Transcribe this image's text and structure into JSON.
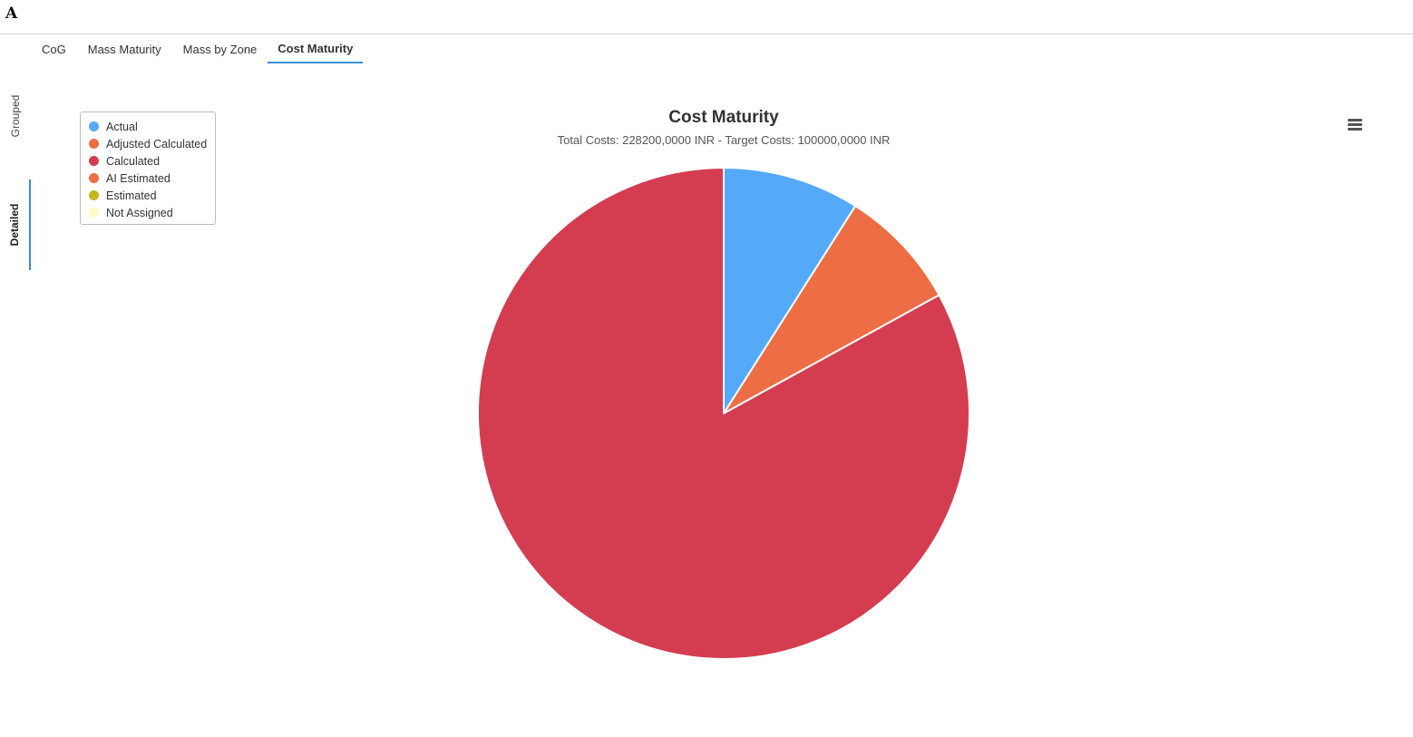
{
  "app": {
    "logo": "A"
  },
  "tabs": [
    {
      "label": "CoG",
      "active": false
    },
    {
      "label": "Mass Maturity",
      "active": false
    },
    {
      "label": "Mass by Zone",
      "active": false
    },
    {
      "label": "Cost Maturity",
      "active": true
    }
  ],
  "side_tabs": {
    "grouped": "Grouped",
    "detailed": "Detailed",
    "active": "detailed"
  },
  "menu_icon": "hamburger-menu-icon",
  "colors": {
    "accent": "#3a8fd8"
  },
  "chart_data": {
    "type": "pie",
    "title": "Cost Maturity",
    "subtitle": "Total Costs: 228200,0000 INR - Target Costs: 100000,0000 INR",
    "legend_position": "top-left",
    "legend": [
      {
        "name": "Actual",
        "color": "#55aaf8"
      },
      {
        "name": "Adjusted Calculated",
        "color": "#ed6d45"
      },
      {
        "name": "Calculated",
        "color": "#d43d50"
      },
      {
        "name": "AI Estimated",
        "color": "#ed6d45"
      },
      {
        "name": "Estimated",
        "color": "#c6b81c"
      },
      {
        "name": "Not Assigned",
        "color": "#fffac4"
      }
    ],
    "slices": [
      {
        "name": "Actual",
        "value": 9,
        "color": "#55aaf8"
      },
      {
        "name": "Adjusted Calculated",
        "value": 8,
        "color": "#ed6d45"
      },
      {
        "name": "Calculated",
        "value": 83,
        "color": "#d43d50"
      }
    ]
  }
}
